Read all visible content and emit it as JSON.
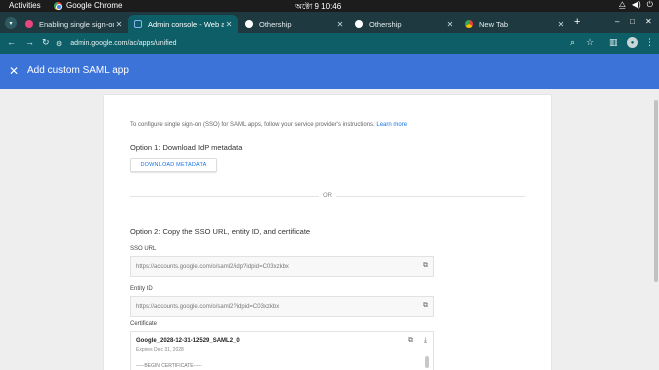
{
  "system": {
    "activities": "Activities",
    "app_name": "Google Chrome",
    "clock": "অক্টো 9  10:46",
    "tray_icons": [
      "network-icon",
      "volume-icon",
      "power-icon"
    ]
  },
  "tabs": [
    {
      "title": "Enabling single sign-on a",
      "favicon": "pink-icon",
      "active": false
    },
    {
      "title": "Admin console - Web an",
      "favicon": "admin-icon",
      "active": true
    },
    {
      "title": "Othership",
      "favicon": "github-icon",
      "active": false
    },
    {
      "title": "Othership",
      "favicon": "github-icon",
      "active": false
    },
    {
      "title": "New Tab",
      "favicon": "chrome-icon",
      "active": false
    }
  ],
  "toolbar": {
    "url": "admin.google.com/ac/apps/unified",
    "icons": [
      "back-icon",
      "forward-icon",
      "reload-icon",
      "zoom-icon",
      "bookmark-star-icon",
      "sidepanel-icon",
      "profile-avatar",
      "menu-icon"
    ]
  },
  "header": {
    "title": "Add custom SAML app"
  },
  "content": {
    "intro_text": "To configure single sign-on (SSO) for SAML apps, follow your service provider's instructions.",
    "learn_more": "Learn more",
    "option1_title": "Option 1: Download IdP metadata",
    "download_button": "DOWNLOAD METADATA",
    "or_text": "OR",
    "option2_title": "Option 2: Copy the SSO URL, entity ID, and certificate",
    "sso_label": "SSO URL",
    "sso_value": "https://accounts.google.com/o/saml2/idp?idpid=C03xzkbx",
    "entity_label": "Entity ID",
    "entity_value": "https://accounts.google.com/o/saml2?idpid=C03xzkbx",
    "cert_label": "Certificate",
    "cert_name": "Google_2028-12-31-12529_SAML2_0",
    "cert_expires": "Expires Dec 31, 2028",
    "cert_begin": "-----BEGIN CERTIFICATE-----"
  },
  "colors": {
    "tabstrip": "#1e3a40",
    "toolbar": "#0e5e67",
    "header": "#3b73d9",
    "link": "#1a73e8"
  }
}
